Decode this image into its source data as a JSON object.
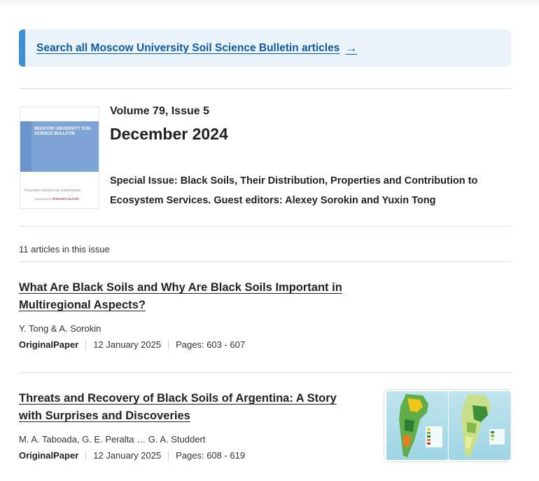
{
  "search": {
    "label": "Search all Moscow University Soil Science Bulletin articles",
    "arrow_icon": "arrow-right-icon"
  },
  "issue": {
    "cover": {
      "journal_title": "MOSCOW UNIVERSITY SOIL SCIENCE BULLETIN",
      "publisher": "PLEIADES GROUP OF COMPANIES",
      "distributed_by": "Distributed by",
      "distributor": "SPRINGER NATURE"
    },
    "volume": "Volume 79, Issue 5",
    "date": "December 2024",
    "special": "Special Issue: Black Soils, Their Distribution, Properties and Contribution to Ecosystem Services. Guest editors: Alexey Sorokin and Yuxin Tong"
  },
  "articles_count": "11 articles in this issue",
  "articles": [
    {
      "title": "What Are Black Soils and Why Are Black Soils Important in Multiregional Aspects?",
      "authors": "Y. Tong & A. Sorokin",
      "type": "OriginalPaper",
      "date": "12 January 2025",
      "pages": "Pages: 603 - 607"
    },
    {
      "title": "Threats and Recovery of Black Soils of Argentina: A Story with Surprises and Discoveries",
      "authors": "M. A. Taboada, G. E. Peralta … G. A. Studdert",
      "type": "OriginalPaper",
      "date": "12 January 2025",
      "pages": "Pages: 608 - 619"
    }
  ],
  "colors": {
    "link": "#0f5aa6",
    "banner_bg": "#eaf2fa",
    "banner_accent": "#3d8fd6",
    "cover_blue": "#7ea3d6"
  }
}
